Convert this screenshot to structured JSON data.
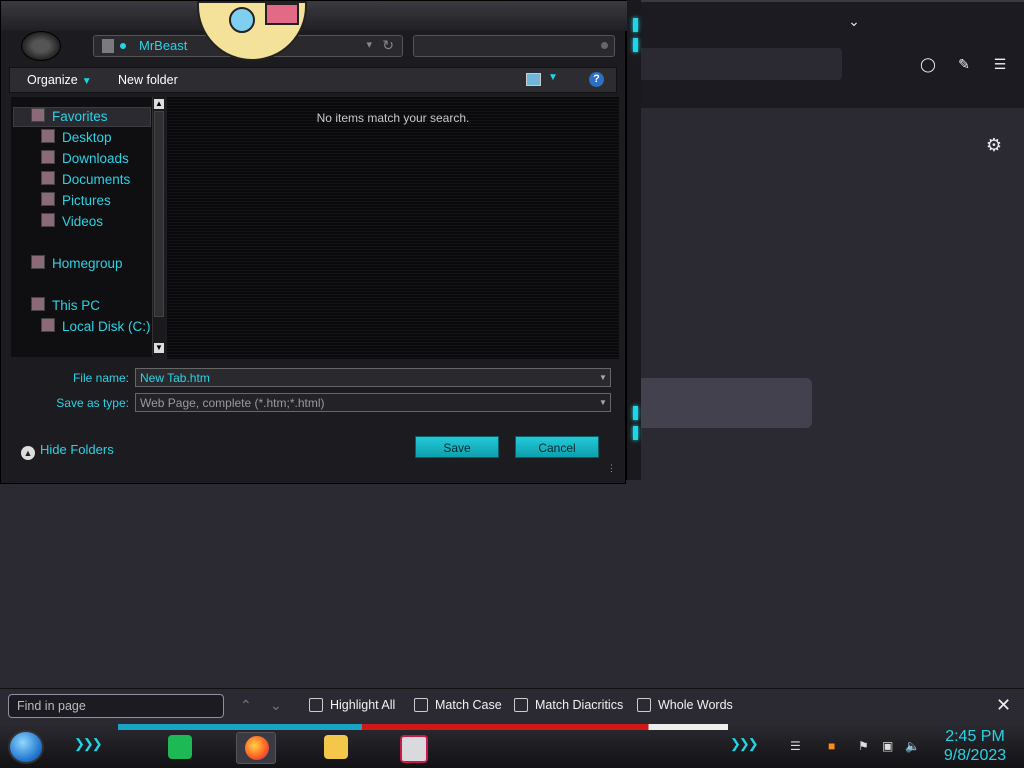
{
  "dialog": {
    "address_text": "MrBeast",
    "toolbar": {
      "organize": "Organize",
      "new_folder": "New folder",
      "help": "?"
    },
    "nav_items": [
      {
        "label": "Favorites",
        "icon": "star-icon",
        "selected": true
      },
      {
        "label": "Desktop",
        "icon": "desktop-icon"
      },
      {
        "label": "Downloads",
        "icon": "downloads-icon"
      },
      {
        "label": "Documents",
        "icon": "documents-icon"
      },
      {
        "label": "Pictures",
        "icon": "pictures-icon"
      },
      {
        "label": "Videos",
        "icon": "videos-icon"
      },
      {
        "label": "Homegroup",
        "icon": "homegroup-icon"
      },
      {
        "label": "This PC",
        "icon": "computer-icon"
      },
      {
        "label": "Local Disk (C:)",
        "icon": "disk-icon"
      }
    ],
    "empty_message": "No items match your search.",
    "file_name_label": "File name:",
    "file_name_value": "New Tab.htm",
    "save_as_type_label": "Save as type:",
    "save_as_type_value": "Web Page, complete (*.htm;*.html)",
    "hide_folders": "Hide Folders",
    "save_button": "Save",
    "cancel_button": "Cancel"
  },
  "findbar": {
    "placeholder": "Find in page",
    "options": [
      "Highlight All",
      "Match Case",
      "Match Diacritics",
      "Whole Words"
    ]
  },
  "taskbar": {
    "apps": [
      "spotify",
      "firefox",
      "file-explorer",
      "media-player"
    ],
    "time": "2:45 PM",
    "date": "9/8/2023"
  },
  "colors": {
    "accent": "#1ed6e6",
    "bg": "#2b2a33",
    "dialog_bg": "#1c1c20"
  }
}
